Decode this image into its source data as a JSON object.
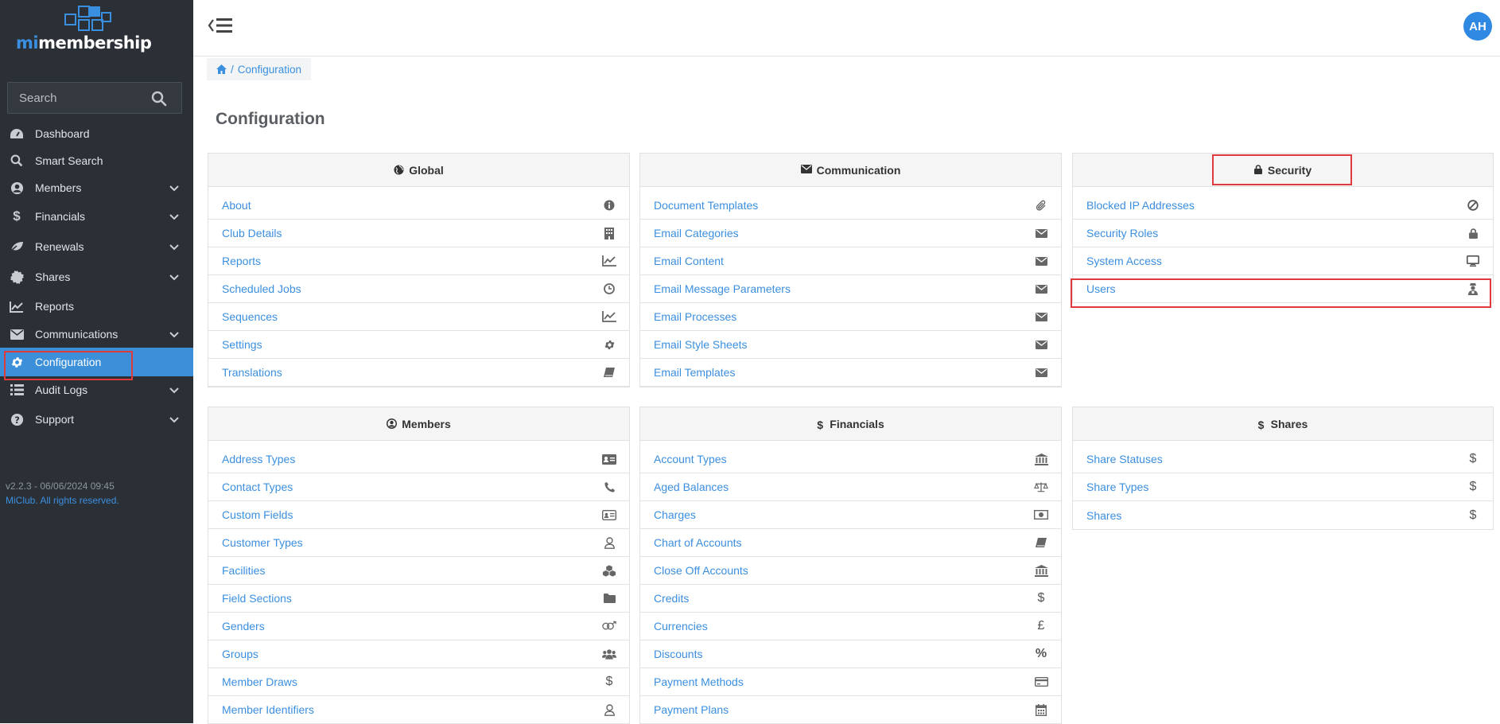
{
  "app": {
    "logo_prefix": "mi",
    "logo_name": "membership",
    "version": "v2.2.3 - 06/06/2024 09:45",
    "copyright": "MiClub. All rights reserved."
  },
  "sidebar": {
    "search_placeholder": "Search",
    "items": [
      {
        "label": "Dashboard",
        "icon": "dashboard-icon"
      },
      {
        "label": "Smart Search",
        "icon": "search-icon"
      },
      {
        "label": "Members",
        "icon": "user-circle-icon"
      },
      {
        "label": "Financials",
        "icon": "dollar-icon"
      },
      {
        "label": "Renewals",
        "icon": "leaf-icon"
      },
      {
        "label": "Shares",
        "icon": "certificate-icon"
      },
      {
        "label": "Reports",
        "icon": "line-chart-icon"
      },
      {
        "label": "Communications",
        "icon": "envelope-icon"
      },
      {
        "label": "Configuration",
        "icon": "gear-icon"
      },
      {
        "label": "Audit Logs",
        "icon": "list-icon"
      },
      {
        "label": "Support",
        "icon": "question-icon"
      }
    ]
  },
  "header": {
    "avatar_initials": "AH"
  },
  "breadcrumb": {
    "current": "Configuration"
  },
  "page": {
    "title": "Configuration"
  },
  "panels": {
    "global": {
      "title": "Global",
      "items": [
        {
          "label": "About",
          "icon": "info-icon"
        },
        {
          "label": "Club Details",
          "icon": "building-icon"
        },
        {
          "label": "Reports",
          "icon": "line-chart-icon"
        },
        {
          "label": "Scheduled Jobs",
          "icon": "clock-icon"
        },
        {
          "label": "Sequences",
          "icon": "line-chart-icon"
        },
        {
          "label": "Settings",
          "icon": "gear-icon"
        },
        {
          "label": "Translations",
          "icon": "book-icon"
        }
      ]
    },
    "communication": {
      "title": "Communication",
      "items": [
        {
          "label": "Document Templates",
          "icon": "paperclip-icon"
        },
        {
          "label": "Email Categories",
          "icon": "envelope-icon"
        },
        {
          "label": "Email Content",
          "icon": "envelope-icon"
        },
        {
          "label": "Email Message Parameters",
          "icon": "envelope-icon"
        },
        {
          "label": "Email Processes",
          "icon": "envelope-icon"
        },
        {
          "label": "Email Style Sheets",
          "icon": "envelope-icon"
        },
        {
          "label": "Email Templates",
          "icon": "envelope-icon"
        }
      ]
    },
    "security": {
      "title": "Security",
      "items": [
        {
          "label": "Blocked IP Addresses",
          "icon": "ban-icon"
        },
        {
          "label": "Security Roles",
          "icon": "lock-icon"
        },
        {
          "label": "System Access",
          "icon": "desktop-icon"
        },
        {
          "label": "Users",
          "icon": "user-secret-icon"
        }
      ]
    },
    "members": {
      "title": "Members",
      "items": [
        {
          "label": "Address Types",
          "icon": "address-card-icon"
        },
        {
          "label": "Contact Types",
          "icon": "phone-icon"
        },
        {
          "label": "Custom Fields",
          "icon": "id-card-icon"
        },
        {
          "label": "Customer Types",
          "icon": "user-outline-icon"
        },
        {
          "label": "Facilities",
          "icon": "cubes-icon"
        },
        {
          "label": "Field Sections",
          "icon": "folder-icon"
        },
        {
          "label": "Genders",
          "icon": "gender-icon"
        },
        {
          "label": "Groups",
          "icon": "users-icon"
        },
        {
          "label": "Member Draws",
          "icon": "dollar-icon"
        },
        {
          "label": "Member Identifiers",
          "icon": "user-outline-icon"
        }
      ]
    },
    "financials": {
      "title": "Financials",
      "items": [
        {
          "label": "Account Types",
          "icon": "bank-icon"
        },
        {
          "label": "Aged Balances",
          "icon": "balance-scale-icon"
        },
        {
          "label": "Charges",
          "icon": "money-icon"
        },
        {
          "label": "Chart of Accounts",
          "icon": "book-icon"
        },
        {
          "label": "Close Off Accounts",
          "icon": "bank-icon"
        },
        {
          "label": "Credits",
          "icon": "dollar-icon"
        },
        {
          "label": "Currencies",
          "icon": "pound-icon"
        },
        {
          "label": "Discounts",
          "icon": "percent-icon"
        },
        {
          "label": "Payment Methods",
          "icon": "credit-card-icon"
        },
        {
          "label": "Payment Plans",
          "icon": "calendar-icon"
        }
      ]
    },
    "shares": {
      "title": "Shares",
      "items": [
        {
          "label": "Share Statuses",
          "icon": "dollar-icon"
        },
        {
          "label": "Share Types",
          "icon": "dollar-icon"
        },
        {
          "label": "Shares",
          "icon": "dollar-icon"
        }
      ]
    }
  },
  "colors": {
    "sidebar_bg": "#2b3036",
    "accent": "#3c8fd9",
    "link": "#3b8fe0",
    "highlight": "#e0393e"
  }
}
